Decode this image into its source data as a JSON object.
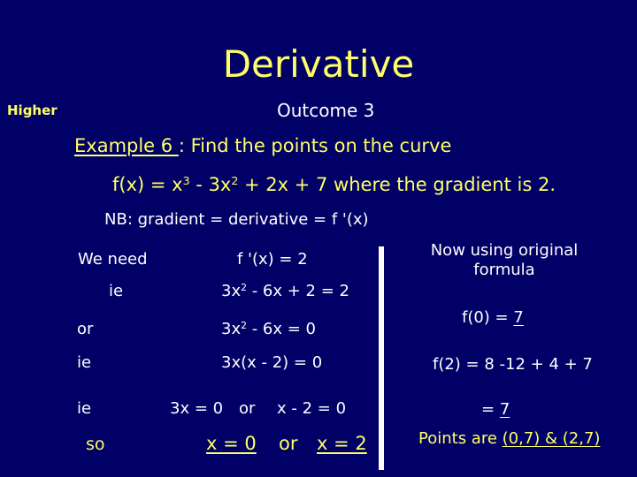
{
  "title": "Derivative",
  "label_higher": "Higher",
  "outcome": "Outcome 3",
  "example": {
    "label": "Example 6 ",
    "text": ": Find the points on the curve"
  },
  "function": {
    "lhs": "f(x)  =  x",
    "exp1": "3",
    "t2": " - 3x",
    "exp2": "2",
    "rest": " + 2x + 7 where the gradient is 2."
  },
  "nb": "NB:  gradient  =  derivative  = f '(x)",
  "working": {
    "we_need": "We need",
    "fprime": "f '(x)  = 2",
    "ie1": "ie",
    "eq1_a": "3x",
    "eq1_exp": "2",
    "eq1_b": " - 6x + 2 = 2",
    "or1": "or",
    "eq2_a": "3x",
    "eq2_exp": "2",
    "eq2_b": " - 6x  = 0",
    "ie2": "ie",
    "eq3": "3x(x - 2) = 0",
    "ie3": "ie",
    "eq4a": "3x = 0",
    "eq4or": "or",
    "eq4b": "x - 2 = 0",
    "so": "so",
    "sol1": "x = 0",
    "solor": "or",
    "sol2": "x = 2"
  },
  "right": {
    "now": "Now using original formula",
    "f0_a": "f(0) = ",
    "f0_b": "7",
    "f2": "f(2) = 8 -12  + 4 + 7",
    "eq7_a": "= ",
    "eq7_b": "7",
    "points_a": "Points are ",
    "points_b": "(0,7)  &  (2,7)"
  },
  "colors": {
    "background": "#000066",
    "highlight": "#ffff66",
    "text": "#ffffff"
  }
}
